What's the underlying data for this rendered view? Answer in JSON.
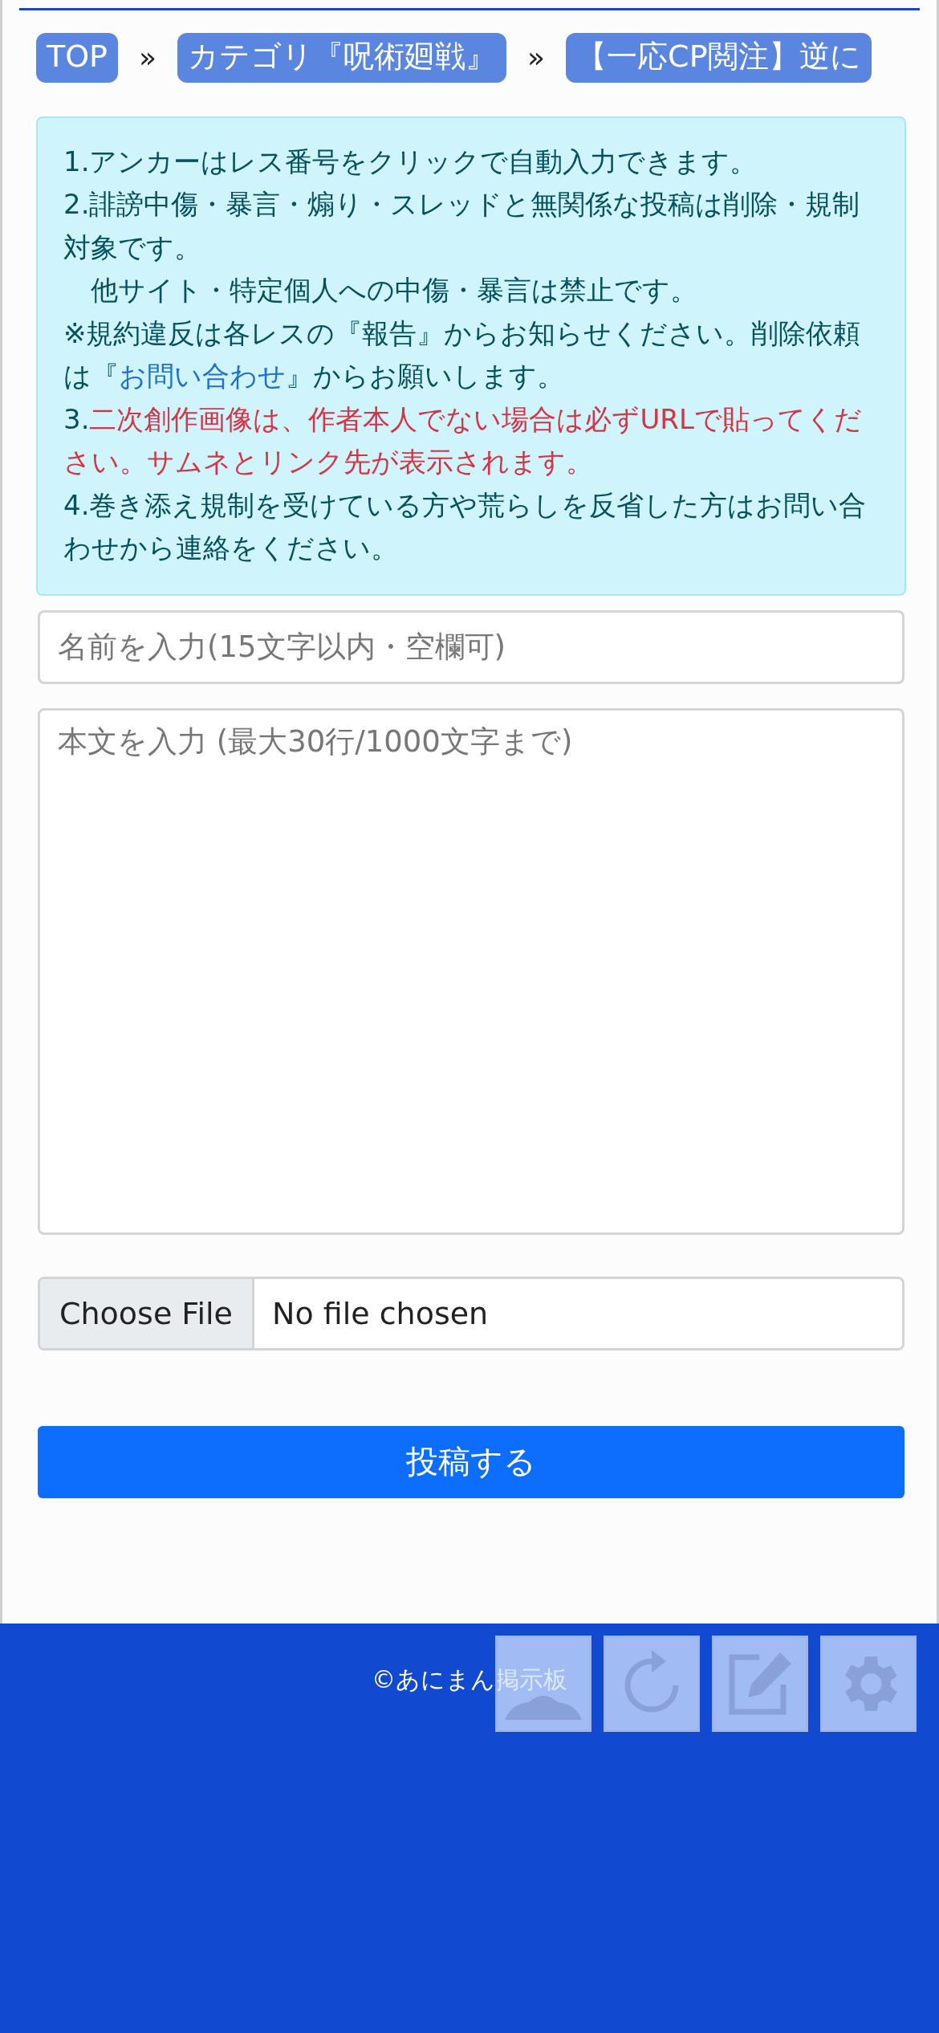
{
  "breadcrumb": [
    {
      "label": "TOP",
      "separator": "»"
    },
    {
      "label": "カテゴリ『呪術廻戦』",
      "separator": "»"
    },
    {
      "label": "【一応CP閲注】逆に"
    }
  ],
  "notice": [
    [
      {
        "kind": "text",
        "text": "1.アンカーはレス番号をクリックで自動入力できます。"
      }
    ],
    [
      {
        "kind": "text",
        "text": "2.誹謗中傷・暴言・煽り・スレッドと無関係な投稿は削除・規制対象です。"
      }
    ],
    [
      {
        "kind": "text",
        "text": "　他サイト・特定個人への中傷・暴言は禁止です。"
      }
    ],
    [
      {
        "kind": "text",
        "text": "※規約違反は各レスの『報告』からお知らせください。削除依頼は『"
      },
      {
        "kind": "link",
        "text": "お問い合わせ"
      },
      {
        "kind": "text",
        "text": "』からお願いします。"
      }
    ],
    [
      {
        "kind": "text",
        "text": "3."
      },
      {
        "kind": "warning",
        "text": "二次創作画像は、作者本人でない場合は必ずURLで貼ってください。サムネとリンク先が表示されます。"
      }
    ],
    [
      {
        "kind": "text",
        "text": "4.巻き添え規制を受けている方や荒らしを反省した方はお問い合わせから連絡をください。"
      }
    ]
  ],
  "form": {
    "name_placeholder": "名前を入力(15文字以内・空欄可)",
    "body_placeholder": "本文を入力 (最大30行/1000文字まで)",
    "file_button": "Choose File",
    "file_status": "No file chosen",
    "submit": "投稿する"
  },
  "footer": {
    "copyright": "©あにまん掲示板"
  }
}
